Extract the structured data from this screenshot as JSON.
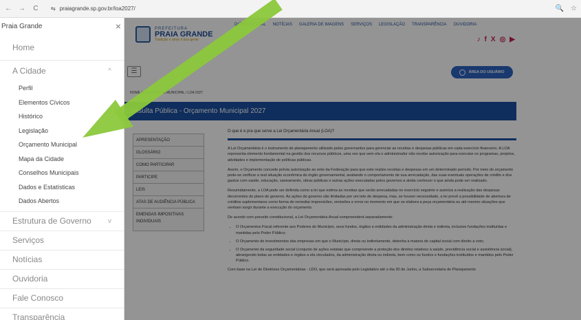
{
  "browser": {
    "url": "praiagrande.sp.gov.br/loa2027/",
    "back": "←",
    "forward": "→",
    "reload": "C",
    "site_info": "⇆",
    "zoom_icon": "🔍",
    "star_icon": "☆"
  },
  "sidebar": {
    "title": "Praia Grande",
    "close": "×",
    "items": [
      {
        "label": "Home"
      },
      {
        "label": "A Cidade",
        "expanded": true,
        "chevron": "^",
        "subitems": [
          "Perfil",
          "Elementos Cívicos",
          "Histórico",
          "Legislação",
          "Orçamento Municipal",
          "Mapa da Cidade",
          "Conselhos Municipais",
          "Dados e Estatísticas",
          "Dados Abertos"
        ]
      },
      {
        "label": "Estrutura de Governo",
        "chevron": "v"
      },
      {
        "label": "Serviços"
      },
      {
        "label": "Notícias"
      },
      {
        "label": "Ouvidoria"
      },
      {
        "label": "Fale Conosco"
      },
      {
        "label": "Transparência"
      }
    ]
  },
  "header": {
    "logo_line1": "PREFEITURA",
    "logo_line2": "PRAIA GRANDE",
    "logo_line3": "Tradição e amor à boa gente",
    "nav": [
      "DIÁRIO OFICIAL",
      "NOTÍCIAS",
      "GALERIA DE IMAGENS",
      "SERVIÇOS",
      "LEGISLAÇÃO",
      "TRANSPARÊNCIA",
      "OUVIDORIA"
    ],
    "user_area": "ÁREA DO USUÁRIO",
    "menu": "☰"
  },
  "breadcrumb": "HOME  /  ORÇAMENTO MUNICIPAL  /  LOA 2027",
  "page_title": "Consulta Pública - Orçamento Municipal 2027",
  "tabs": [
    "APRESENTAÇÃO",
    "GLOSSÁRIO",
    "COMO PARTICIPAR",
    "PARTICIPE",
    "LEIS",
    "ATAS DE AUDIÊNCIA PÚBLICA",
    "EMENDAS IMPOSITIVAS INDIVIDUAIS"
  ],
  "content": {
    "question": "O que é e pra que serve a Lei Orçamentária Anual (LOA)?",
    "p1": "A Lei Orçamentária é o instrumento de planejamento utilizado pelos governantes para gerenciar as receitas e despesas públicas em cada exercício financeiro. A LOA representa elemento fundamental na gestão dos recursos públicos, uma vez que sem ela o administrador não recebe autorização para executar os programas, projetos, atividades e implementação de políticas públicas.",
    "p2": "Assim, o Orçamento concede prévia autorização ao ente da Federação para que este realize receitas e despesas em um determinado período. Por meio do orçamento pode-se verificar a real situação econômica do órgão governamental, avaliando o comportamento de sua arrecadação, das suas eventuais operações de crédito e dos gastos com saúde, educação, saneamento, obras públicas e outras ações executadas pelos governos a ainda conhecer o que ainda pode ser realizado.",
    "p3": "Resumidamente, a LOA pode ser definida como a lei que estima as receitas que serão arrecadadas no exercício seguinte e autoriza a realização das despesas decorrentes do plano de governo. As ações de governo são limitadas por um teto de despesa, mas, se houver necessidade, a lei prevê a possibilidade de abertura de créditos suplementares como forma de remediar imprevisões, omissões e erros no momento em que se elabora a peça orçamentária ou até mesmo situações que venham surgir durante a execução do orçamento.",
    "p4": "De acordo com preceito constitucional, a Lei Orçamentária Anual compreenderá separadamente:",
    "bullets": [
      "O Orçamentos Fiscal referente aos Poderes do Município, seus fundos, órgãos e entidades da administração direta e indireta, inclusive fundações instituídas e mantidas pelo Poder Público;",
      "O Orçamento de investimentos das empresas em que o Município, direta ou indiretamente, detenha a maioria do capital social com direito a voto;",
      "O Orçamento da seguridade social (conjunto de ações estatais que compreende a proteção dos direitos relativos à saúde, previdência social e assistência social), abrangendo todas as entidades e órgãos a ela vinculados, da administração direta ou indireta, bem como os fundos e fundações instituídos e mantidos pelo Poder Público."
    ],
    "p5": "Com base na Lei de Diretrizes Orçamentárias - LDO, que será aprovada pelo Legislativo até o dia 30 de Junho, a Subsecretaria de Planejamento"
  },
  "colors": {
    "brand": "#1a4fa0",
    "arrow": "#8cc83c"
  }
}
